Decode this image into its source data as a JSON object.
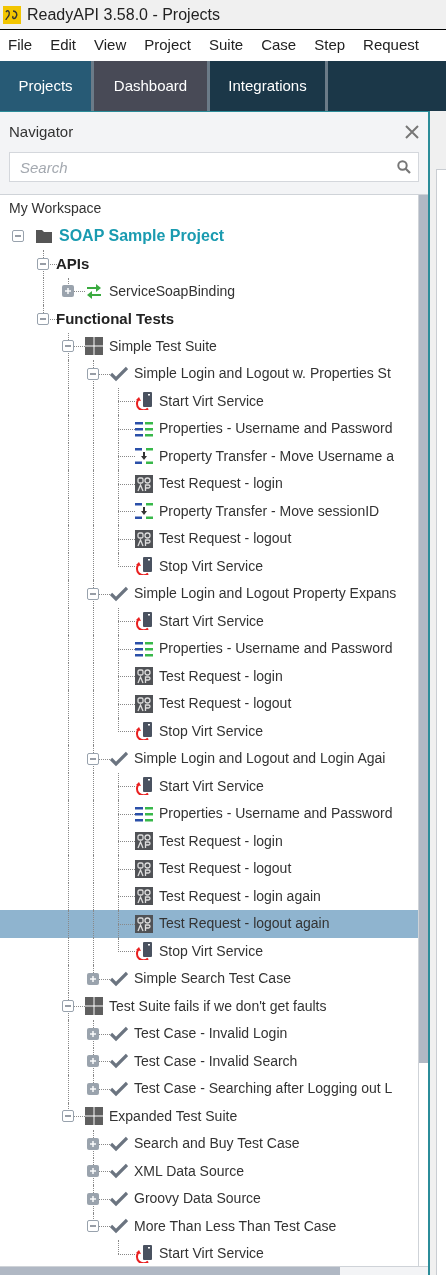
{
  "window": {
    "title": "ReadyAPI 3.58.0 - Projects"
  },
  "menu": [
    "File",
    "Edit",
    "View",
    "Project",
    "Suite",
    "Case",
    "Step",
    "Request"
  ],
  "tabs": [
    {
      "label": "Projects",
      "selected": true,
      "hovered": false
    },
    {
      "label": "Dashboard",
      "selected": false,
      "hovered": true
    },
    {
      "label": "Integrations",
      "selected": false,
      "hovered": false
    }
  ],
  "navigator": {
    "title": "Navigator",
    "search": {
      "placeholder": "Search"
    },
    "workspace": "My Workspace",
    "tree": [
      {
        "label": "SOAP Sample Project",
        "kind": "project",
        "expanded": true,
        "selected": false,
        "children": [
          {
            "label": "APIs",
            "kind": "folder",
            "expanded": true,
            "selected": false,
            "children": [
              {
                "label": "ServiceSoapBinding",
                "kind": "interface",
                "expanded": false,
                "selected": false
              }
            ]
          },
          {
            "label": "Functional Tests",
            "kind": "folder",
            "expanded": true,
            "selected": false,
            "children": [
              {
                "label": "Simple Test Suite",
                "kind": "suite",
                "expanded": true,
                "selected": false,
                "children": [
                  {
                    "label": "Simple Login and Logout w. Properties St",
                    "kind": "case",
                    "expanded": true,
                    "selected": false,
                    "children": [
                      {
                        "label": "Start Virt Service",
                        "kind": "virt",
                        "selected": false
                      },
                      {
                        "label": "Properties - Username and Password",
                        "kind": "properties",
                        "selected": false
                      },
                      {
                        "label": "Property Transfer - Move Username a",
                        "kind": "transfer",
                        "selected": false
                      },
                      {
                        "label": "Test Request - login",
                        "kind": "soap",
                        "selected": false
                      },
                      {
                        "label": "Property Transfer - Move sessionID",
                        "kind": "transfer",
                        "selected": false
                      },
                      {
                        "label": "Test Request - logout",
                        "kind": "soap",
                        "selected": false
                      },
                      {
                        "label": "Stop Virt Service",
                        "kind": "virt",
                        "selected": false
                      }
                    ]
                  },
                  {
                    "label": "Simple Login and Logout Property Expans",
                    "kind": "case",
                    "expanded": true,
                    "selected": false,
                    "children": [
                      {
                        "label": "Start Virt Service",
                        "kind": "virt",
                        "selected": false
                      },
                      {
                        "label": "Properties - Username and Password",
                        "kind": "properties",
                        "selected": false
                      },
                      {
                        "label": "Test Request - login",
                        "kind": "soap",
                        "selected": false
                      },
                      {
                        "label": "Test Request - logout",
                        "kind": "soap",
                        "selected": false
                      },
                      {
                        "label": "Stop Virt Service",
                        "kind": "virt",
                        "selected": false
                      }
                    ]
                  },
                  {
                    "label": "Simple Login and Logout and Login Agai",
                    "kind": "case",
                    "expanded": true,
                    "selected": false,
                    "children": [
                      {
                        "label": "Start Virt Service",
                        "kind": "virt",
                        "selected": false
                      },
                      {
                        "label": "Properties - Username and Password",
                        "kind": "properties",
                        "selected": false
                      },
                      {
                        "label": "Test Request - login",
                        "kind": "soap",
                        "selected": false
                      },
                      {
                        "label": "Test Request - logout",
                        "kind": "soap",
                        "selected": false
                      },
                      {
                        "label": "Test Request - login again",
                        "kind": "soap",
                        "selected": false
                      },
                      {
                        "label": "Test Request - logout again",
                        "kind": "soap",
                        "selected": true
                      },
                      {
                        "label": "Stop Virt Service",
                        "kind": "virt",
                        "selected": false
                      }
                    ]
                  },
                  {
                    "label": "Simple Search Test Case",
                    "kind": "case",
                    "expanded": false,
                    "selected": false
                  }
                ]
              },
              {
                "label": "Test Suite fails if we don't get faults",
                "kind": "suite",
                "expanded": true,
                "selected": false,
                "children": [
                  {
                    "label": "Test Case - Invalid Login",
                    "kind": "case",
                    "expanded": false,
                    "selected": false
                  },
                  {
                    "label": "Test Case - Invalid Search",
                    "kind": "case",
                    "expanded": false,
                    "selected": false
                  },
                  {
                    "label": "Test Case - Searching after Logging out L",
                    "kind": "case",
                    "expanded": false,
                    "selected": false
                  }
                ]
              },
              {
                "label": "Expanded Test Suite",
                "kind": "suite",
                "expanded": true,
                "selected": false,
                "children": [
                  {
                    "label": "Search and Buy Test Case",
                    "kind": "case",
                    "expanded": false,
                    "selected": false
                  },
                  {
                    "label": "XML Data Source",
                    "kind": "case",
                    "expanded": false,
                    "selected": false
                  },
                  {
                    "label": "Groovy Data Source",
                    "kind": "case",
                    "expanded": false,
                    "selected": false
                  },
                  {
                    "label": "More Than Less Than Test Case",
                    "kind": "case",
                    "expanded": true,
                    "selected": false,
                    "children": [
                      {
                        "label": "Start Virt Service",
                        "kind": "virt",
                        "selected": false
                      }
                    ]
                  }
                ]
              }
            ]
          }
        ]
      }
    ]
  }
}
